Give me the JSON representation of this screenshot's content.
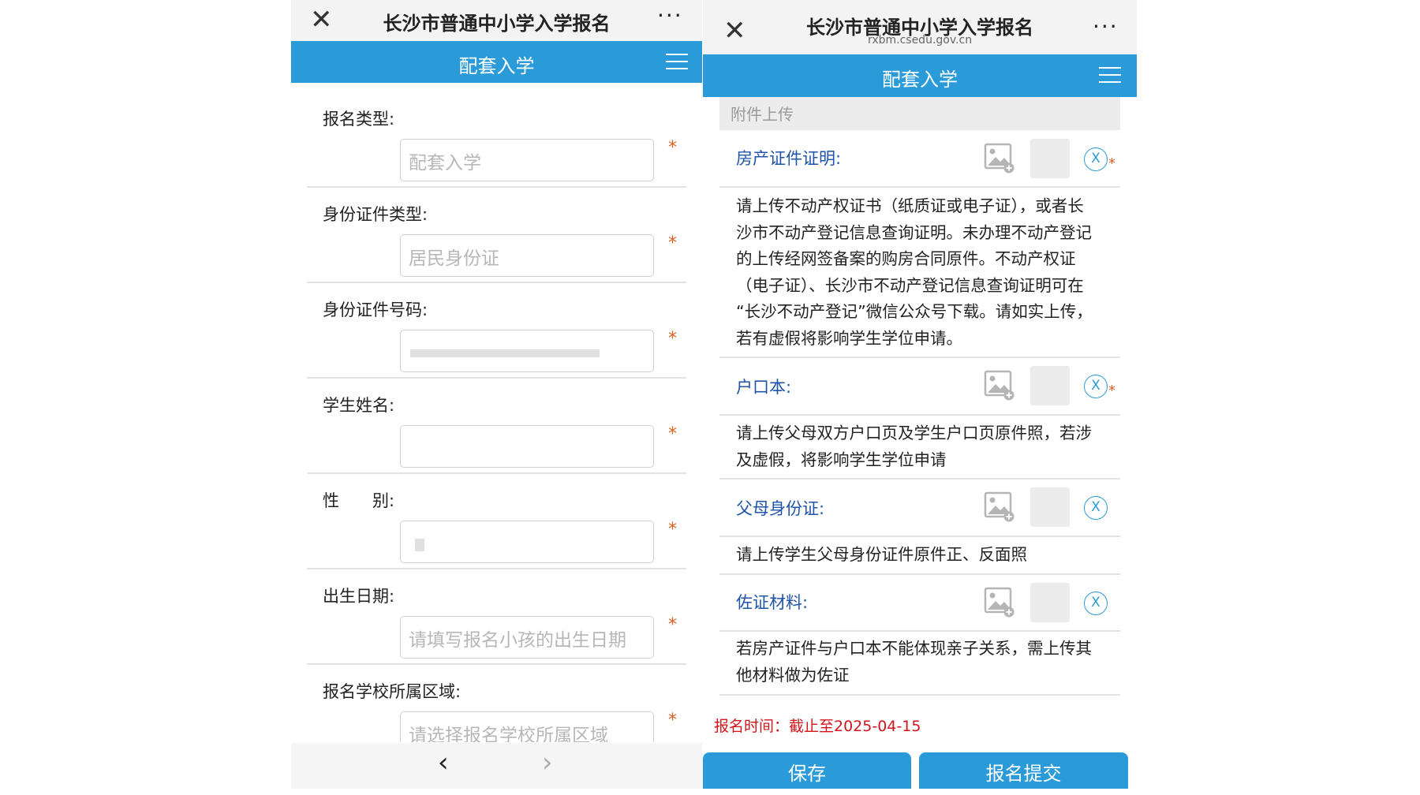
{
  "left": {
    "nav": {
      "title": "长沙市普通中小学入学报名",
      "more": "···",
      "close": "✕"
    },
    "bar": {
      "title": "配套入学"
    },
    "fields": [
      {
        "label": "报名类型:",
        "placeholder": "配套入学",
        "required": "*"
      },
      {
        "label": "身份证件类型:",
        "placeholder": "居民身份证",
        "required": "*"
      },
      {
        "label": "身份证件号码:",
        "placeholder": "",
        "required": "*"
      },
      {
        "label": "学生姓名:",
        "placeholder": "",
        "required": "*"
      },
      {
        "label": "性　　别:",
        "placeholder": "",
        "required": "*"
      },
      {
        "label": "出生日期:",
        "placeholder": "请填写报名小孩的出生日期",
        "required": "*"
      },
      {
        "label": "报名学校所属区域:",
        "placeholder": "请选择报名学校所属区域",
        "required": "*"
      }
    ],
    "bottom_nav": {
      "back": "‹",
      "forward": "›"
    }
  },
  "right": {
    "nav": {
      "title": "长沙市普通中小学入学报名",
      "subtitle": "rxbm.csedu.gov.cn",
      "more": "···",
      "close": "✕"
    },
    "bar": {
      "title": "配套入学"
    },
    "section": "附件上传",
    "uploads": [
      {
        "label": "房产证件证明:",
        "remove": "X",
        "required": "*",
        "desc": [
          "请上传不动产权证书（纸质证或电子证），或者长",
          "沙市不动产登记信息查询证明。未办理不动产登记",
          "的上传经网签备案的购房合同原件。不动产权证",
          "（电子证）、长沙市不动产登记信息查询证明可在",
          "“长沙不动产登记”微信公众号下载。请如实上传，",
          "若有虚假将影响学生学位申请。"
        ]
      },
      {
        "label": "户口本:",
        "remove": "X",
        "required": "*",
        "desc": [
          "请上传父母双方户口页及学生户口页原件照，若涉",
          "及虚假，将影响学生学位申请"
        ]
      },
      {
        "label": "父母身份证:",
        "remove": "X",
        "required": "",
        "desc": [
          "请上传学生父母身份证件原件正、反面照"
        ]
      },
      {
        "label": "佐证材料:",
        "remove": "X",
        "required": "",
        "desc": [
          "若房产证件与户口本不能体现亲子关系，需上传其",
          "他材料做为佐证"
        ]
      }
    ],
    "deadline": "报名时间：截止至2025-04-15",
    "buttons": {
      "save": "保存",
      "submit": "报名提交"
    }
  },
  "colors": {
    "accent": "#2a9ad9",
    "required": "#e06020",
    "upload_label": "#1f54a8",
    "deadline": "#d0161b"
  }
}
